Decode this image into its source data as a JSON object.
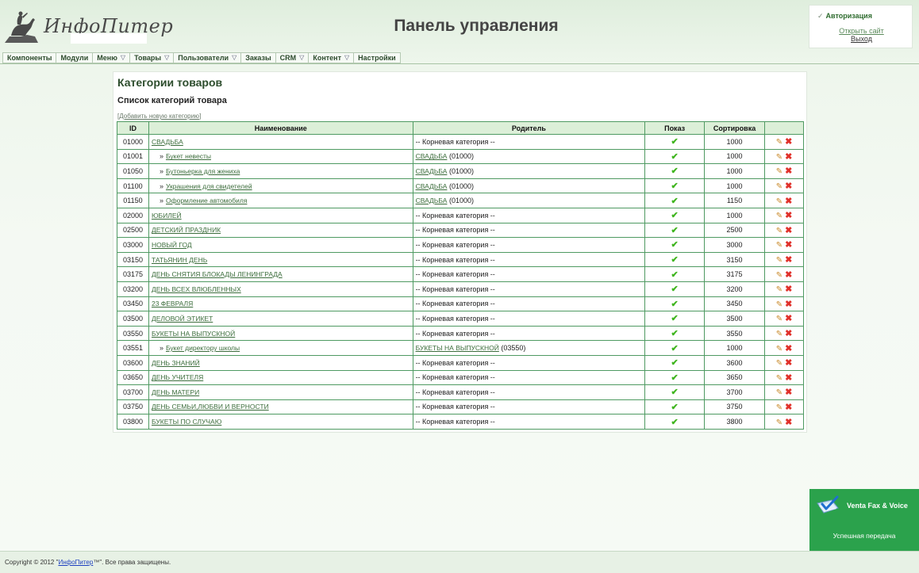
{
  "header": {
    "logo_text": "ИнфоПитер",
    "title": "Панель управления"
  },
  "auth": {
    "title": "Авторизация",
    "open_site": "Открыть сайт",
    "logout": "Выход"
  },
  "menu": [
    {
      "label": "Компоненты",
      "dropdown": false
    },
    {
      "label": "Модули",
      "dropdown": false
    },
    {
      "label": "Меню",
      "dropdown": true
    },
    {
      "label": "Товары",
      "dropdown": true
    },
    {
      "label": "Пользователи",
      "dropdown": true
    },
    {
      "label": "Заказы",
      "dropdown": false
    },
    {
      "label": "CRM",
      "dropdown": true
    },
    {
      "label": "Контент",
      "dropdown": true
    },
    {
      "label": "Настройки",
      "dropdown": false
    }
  ],
  "content": {
    "heading": "Категории товаров",
    "subheading": "Список категорий товара",
    "add_link": "Добавить новую категорию",
    "columns": [
      "ID",
      "Наименование",
      "Родитель",
      "Показ",
      "Сортировка"
    ],
    "rows": [
      {
        "id": "01000",
        "name": "СВАДЬБА",
        "sub": false,
        "parent_link": "",
        "parent_text": "-- Корневая категория --",
        "sort": "1000"
      },
      {
        "id": "01001",
        "name": "Букет невесты",
        "sub": true,
        "parent_link": "СВАДЬБА",
        "parent_text": "(01000)",
        "sort": "1000"
      },
      {
        "id": "01050",
        "name": "Бутоньерка для жениха",
        "sub": true,
        "parent_link": "СВАДЬБА",
        "parent_text": "(01000)",
        "sort": "1000"
      },
      {
        "id": "01100",
        "name": "Украшения для свидетелей",
        "sub": true,
        "parent_link": "СВАДЬБА",
        "parent_text": "(01000)",
        "sort": "1000"
      },
      {
        "id": "01150",
        "name": "Оформление автомобиля",
        "sub": true,
        "parent_link": "СВАДЬБА",
        "parent_text": "(01000)",
        "sort": "1150"
      },
      {
        "id": "02000",
        "name": "ЮБИЛЕЙ",
        "sub": false,
        "parent_link": "",
        "parent_text": "-- Корневая категория --",
        "sort": "1000"
      },
      {
        "id": "02500",
        "name": "ДЕТСКИЙ ПРАЗДНИК",
        "sub": false,
        "parent_link": "",
        "parent_text": "-- Корневая категория --",
        "sort": "2500"
      },
      {
        "id": "03000",
        "name": "НОВЫЙ ГОД",
        "sub": false,
        "parent_link": "",
        "parent_text": "-- Корневая категория --",
        "sort": "3000"
      },
      {
        "id": "03150",
        "name": "ТАТЬЯНИН ДЕНЬ",
        "sub": false,
        "parent_link": "",
        "parent_text": "-- Корневая категория --",
        "sort": "3150"
      },
      {
        "id": "03175",
        "name": "ДЕНЬ СНЯТИЯ БЛОКАДЫ ЛЕНИНГРАДА",
        "sub": false,
        "parent_link": "",
        "parent_text": "-- Корневая категория --",
        "sort": "3175"
      },
      {
        "id": "03200",
        "name": "ДЕНЬ ВСЕХ ВЛЮБЛЕННЫХ",
        "sub": false,
        "parent_link": "",
        "parent_text": "-- Корневая категория --",
        "sort": "3200"
      },
      {
        "id": "03450",
        "name": "23 ФЕВРАЛЯ",
        "sub": false,
        "parent_link": "",
        "parent_text": "-- Корневая категория --",
        "sort": "3450"
      },
      {
        "id": "03500",
        "name": "ДЕЛОВОЙ ЭТИКЕТ",
        "sub": false,
        "parent_link": "",
        "parent_text": "-- Корневая категория --",
        "sort": "3500"
      },
      {
        "id": "03550",
        "name": "БУКЕТЫ НА ВЫПУСКНОЙ",
        "sub": false,
        "parent_link": "",
        "parent_text": "-- Корневая категория --",
        "sort": "3550"
      },
      {
        "id": "03551",
        "name": "Букет директору школы",
        "sub": true,
        "parent_link": "БУКЕТЫ НА ВЫПУСКНОЙ",
        "parent_text": "(03550)",
        "sort": "1000"
      },
      {
        "id": "03600",
        "name": "ДЕНЬ ЗНАНИЙ",
        "sub": false,
        "parent_link": "",
        "parent_text": "-- Корневая категория --",
        "sort": "3600"
      },
      {
        "id": "03650",
        "name": "ДЕНЬ УЧИТЕЛЯ",
        "sub": false,
        "parent_link": "",
        "parent_text": "-- Корневая категория --",
        "sort": "3650"
      },
      {
        "id": "03700",
        "name": "ДЕНЬ МАТЕРИ",
        "sub": false,
        "parent_link": "",
        "parent_text": "-- Корневая категория --",
        "sort": "3700"
      },
      {
        "id": "03750",
        "name": "ДЕНЬ СЕМЬИ,ЛЮБВИ И ВЕРНОСТИ",
        "sub": false,
        "parent_link": "",
        "parent_text": "-- Корневая категория --",
        "sort": "3750"
      },
      {
        "id": "03800",
        "name": "БУКЕТЫ ПО СЛУЧАЮ",
        "sub": false,
        "parent_link": "",
        "parent_text": "-- Корневая категория --",
        "sort": "3800"
      }
    ]
  },
  "notification": {
    "title": "Venta Fax & Voice",
    "status": "Успешная передача"
  },
  "footer": {
    "prefix": "Copyright © 2012 \"",
    "link": "ИнфоПитер",
    "suffix": "™\". Все права защищены."
  },
  "colors": {
    "brand_green": "#2d6b2d",
    "table_border": "#4f9a62",
    "table_header_bg": "#dcefd8",
    "notification_bg": "#2ba24c",
    "tick": "#3fb51e",
    "delete": "#e0302a"
  },
  "icons": {
    "show": "check-icon",
    "edit": "pencil-icon",
    "delete": "delete-icon"
  }
}
